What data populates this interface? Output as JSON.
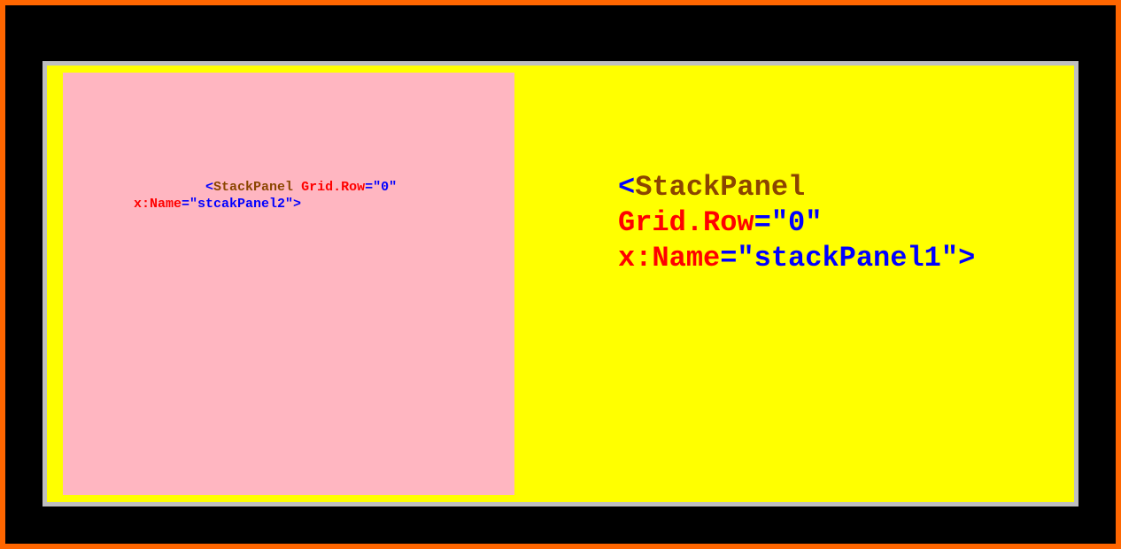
{
  "leftPanel": {
    "segments": [
      {
        "cls": "c-gray",
        "text": "         "
      },
      {
        "cls": "c-blue",
        "text": "<"
      },
      {
        "cls": "c-brown",
        "text": "StackPanel "
      },
      {
        "cls": "c-red",
        "text": "Grid.Row"
      },
      {
        "cls": "c-blue",
        "text": "=\"0\""
      },
      {
        "cls": "",
        "text": "\n"
      },
      {
        "cls": "c-red",
        "text": "x:Name"
      },
      {
        "cls": "c-blue",
        "text": "=\"stcakPanel2\">"
      }
    ]
  },
  "rightPanel": {
    "segments": [
      {
        "cls": "c-blue",
        "text": "<"
      },
      {
        "cls": "c-brown",
        "text": "StackPanel"
      },
      {
        "cls": "",
        "text": "\n"
      },
      {
        "cls": "c-red",
        "text": "Grid.Row"
      },
      {
        "cls": "c-blue",
        "text": "=\"0\""
      },
      {
        "cls": "",
        "text": "\n"
      },
      {
        "cls": "c-red",
        "text": "x:Name"
      },
      {
        "cls": "c-blue",
        "text": "=\"stackPanel1\">"
      }
    ]
  }
}
